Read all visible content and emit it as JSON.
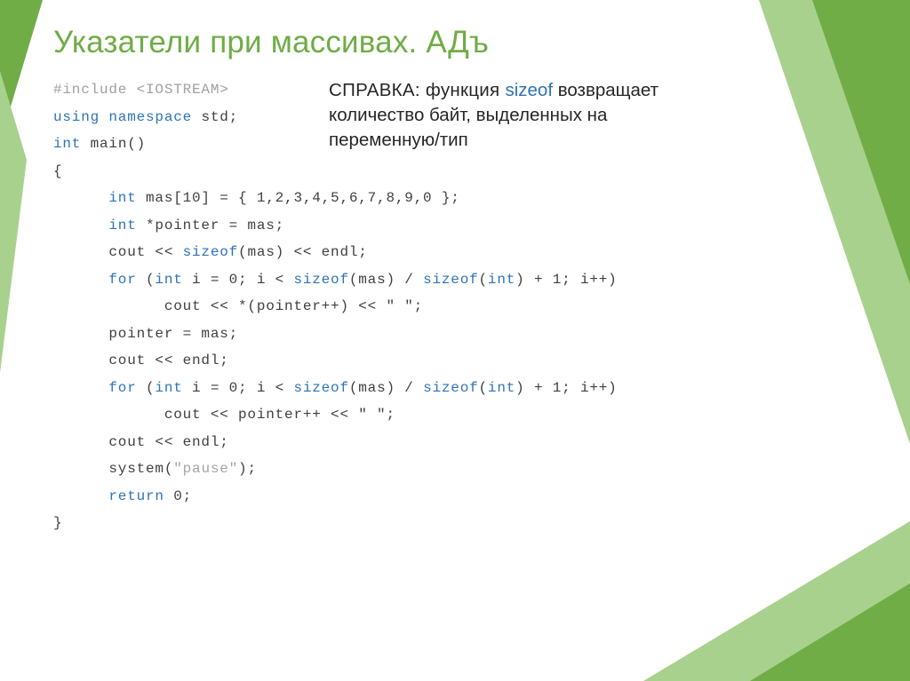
{
  "title": "Указатели при массивах. АДъ",
  "note": {
    "lead": "СПРАВКА: функция ",
    "keyword": "sizeof",
    "rest": " возвращает количество байт, выделенных на переменную/тип"
  },
  "code": {
    "l01a": "#include ",
    "l01b": "<iostream>",
    "l02a": "using namespace ",
    "l02b": "std;",
    "l03a": "int ",
    "l03b": "main()",
    "l04": "{",
    "l05a": "      int ",
    "l05b": "mas[10] = { 1,2,3,4,5,6,7,8,9,0 };",
    "l06a": "      int ",
    "l06b": "*pointer = mas;",
    "l07a": "      cout << ",
    "l07b": "sizeof",
    "l07c": "(mas) << endl;",
    "l08a": "      for ",
    "l08b": "(",
    "l08c": "int ",
    "l08d": "i = 0; i < ",
    "l08e": "sizeof",
    "l08f": "(mas) / ",
    "l08g": "sizeof",
    "l08h": "(",
    "l08i": "int",
    "l08j": ") + 1; i++)",
    "l09": "            cout << *(pointer++) << \" \";",
    "l10": "      pointer = mas;",
    "l11": "      cout << endl;",
    "l12a": "      for ",
    "l12b": "(",
    "l12c": "int ",
    "l12d": "i = 0; i < ",
    "l12e": "sizeof",
    "l12f": "(mas) / ",
    "l12g": "sizeof",
    "l12h": "(",
    "l12i": "int",
    "l12j": ") + 1; i++)",
    "l13": "            cout << pointer++ << \" \";",
    "l14": "      cout << endl;",
    "l15a": "      system(",
    "l15b": "\"pause\"",
    "l15c": ");",
    "l16a": "      return ",
    "l16b": "0;",
    "l17": "}"
  }
}
